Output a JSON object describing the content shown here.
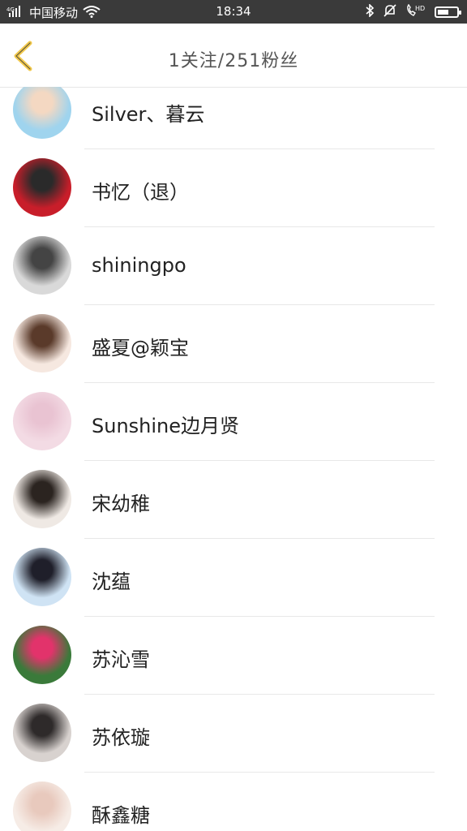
{
  "status_bar": {
    "signal_label": "4G",
    "carrier": "中国移动",
    "time": "18:34",
    "hd_label": "HD",
    "icons": [
      "signal-icon",
      "wifi-icon",
      "bluetooth-icon",
      "mute-icon",
      "hd-call-icon",
      "battery-icon"
    ],
    "battery_level": 0.6
  },
  "header": {
    "title": "1关注/251粉丝",
    "back_icon": "chevron-left-icon",
    "accent_color": "#f2c94c"
  },
  "users": [
    {
      "name": "Silver、暮云",
      "avatar_colors": [
        "#9fd4ee",
        "#f4d8c2"
      ]
    },
    {
      "name": "书忆（退）",
      "avatar_colors": [
        "#c81e2a",
        "#2a2a2a"
      ]
    },
    {
      "name": "shiningpo",
      "avatar_colors": [
        "#d9d9d9",
        "#444444"
      ]
    },
    {
      "name": "盛夏@颖宝",
      "avatar_colors": [
        "#f6e8e0",
        "#5a3a2a"
      ]
    },
    {
      "name": "Sunshine边月贤",
      "avatar_colors": [
        "#f3dbe4",
        "#e9c3d2"
      ]
    },
    {
      "name": "宋幼稚",
      "avatar_colors": [
        "#efe9e4",
        "#2b2420"
      ]
    },
    {
      "name": "沈蕴",
      "avatar_colors": [
        "#cfe3f4",
        "#1f1f2a"
      ]
    },
    {
      "name": "苏沁雪",
      "avatar_colors": [
        "#3a7a3a",
        "#e2336b"
      ]
    },
    {
      "name": "苏依璇",
      "avatar_colors": [
        "#d8d2cf",
        "#2e2a2a"
      ]
    },
    {
      "name": "酥鑫糖",
      "avatar_colors": [
        "#f6ece6",
        "#e8c9bd"
      ]
    }
  ]
}
